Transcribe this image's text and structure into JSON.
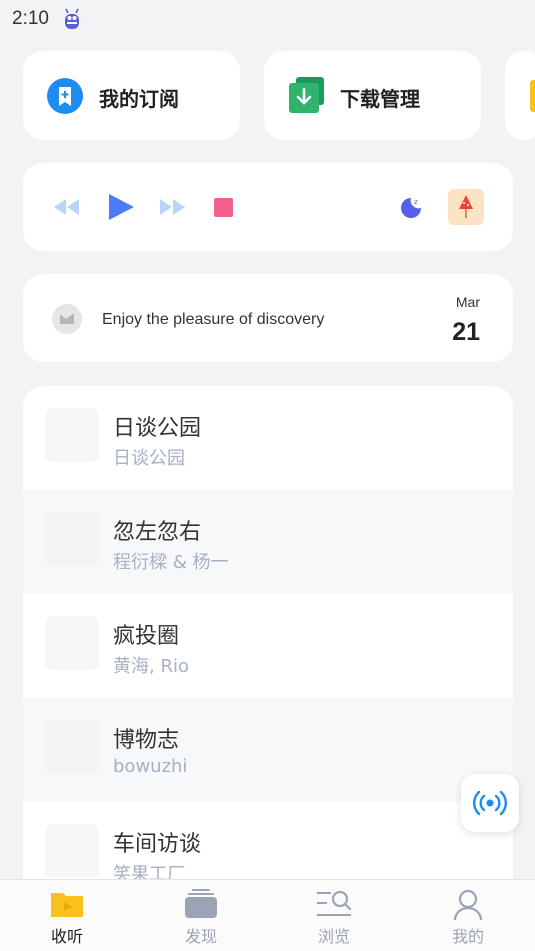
{
  "status_bar": {
    "time": "2:10"
  },
  "shortcuts": [
    {
      "label": "我的订阅",
      "icon": "bookmark-icon"
    },
    {
      "label": "下载管理",
      "icon": "download-icon"
    },
    {
      "label": "",
      "icon": "folder-icon"
    }
  ],
  "player": {
    "controls": [
      "rewind-icon",
      "play-icon",
      "fast-forward-icon",
      "stop-icon",
      "sleep-timer-icon",
      "popsicle-icon"
    ]
  },
  "daily": {
    "slogan": "Enjoy the pleasure of discovery",
    "month": "Mar",
    "day": "21"
  },
  "podcasts": [
    {
      "title": "日谈公园",
      "author": "日谈公园"
    },
    {
      "title": "忽左忽右",
      "author": "程衍樑 & 杨一"
    },
    {
      "title": "疯投圈",
      "author": "黄海, Rio"
    },
    {
      "title": "博物志",
      "author": "bowuzhi"
    },
    {
      "title": "车间访谈",
      "author": "笑果工厂"
    }
  ],
  "tabs": [
    {
      "label": "收听",
      "icon": "listen-folder-icon",
      "active": true
    },
    {
      "label": "发现",
      "icon": "stack-icon",
      "active": false
    },
    {
      "label": "浏览",
      "icon": "browse-search-icon",
      "active": false
    },
    {
      "label": "我的",
      "icon": "person-icon",
      "active": false
    }
  ],
  "colors": {
    "accent": "#4a7df5",
    "subscribe_blue": "#1e8cf0",
    "download_green": "#2fb36d",
    "stop_pink": "#f5608a",
    "tab_active_yellow": "#f7c21b",
    "tab_inactive": "#9aa4b4"
  }
}
